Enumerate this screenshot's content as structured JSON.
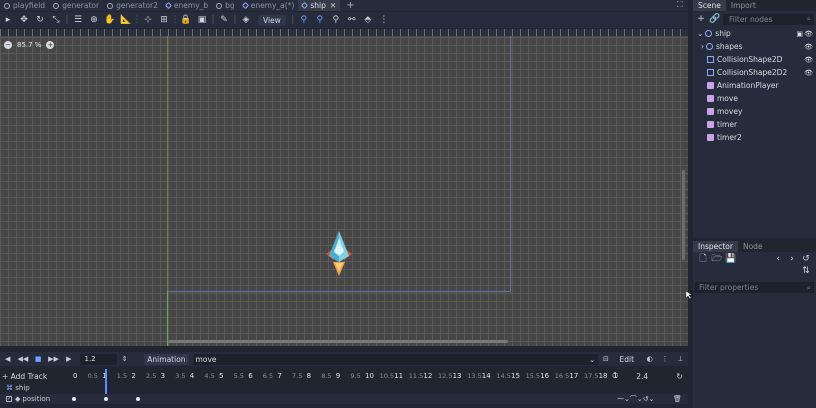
{
  "tabs": [
    {
      "label": "playfield",
      "icon": "circle"
    },
    {
      "label": "generator",
      "icon": "circle"
    },
    {
      "label": "generator2",
      "icon": "circle"
    },
    {
      "label": "enemy_b",
      "icon": "node2d"
    },
    {
      "label": "bg",
      "icon": "circle"
    },
    {
      "label": "enemy_a(*)",
      "icon": "node2d"
    },
    {
      "label": "ship",
      "icon": "node2d",
      "active": true
    }
  ],
  "toolbar": {
    "view_label": "View"
  },
  "viewport": {
    "zoom_label": "85.7 %"
  },
  "animation": {
    "time_value": "1.2",
    "animation_label": "Animation",
    "animation_name": "move",
    "edit_label": "Edit",
    "add_track_label": "Add Track",
    "length_value": "2.4",
    "ticks": [
      "0",
      "0.5",
      "1",
      "1.5",
      "2",
      "2.5",
      "3",
      "3.5",
      "4",
      "4.5",
      "5",
      "5.5",
      "6",
      "6.5",
      "7",
      "7.5",
      "8",
      "8.5",
      "9",
      "9.5",
      "10",
      "10.5",
      "11",
      "11.5",
      "12",
      "12.5",
      "13",
      "13.5",
      "14",
      "14.5",
      "15",
      "15.5",
      "16",
      "16.5",
      "17",
      "17.5",
      "18",
      "1"
    ],
    "track_group": "ship",
    "track_property": "position"
  },
  "scene_dock": {
    "tabs": [
      "Scene",
      "Import"
    ],
    "filter_placeholder": "Filter nodes",
    "nodes": [
      {
        "label": "ship",
        "icon": "n2d",
        "indent": 0,
        "visible": true
      },
      {
        "label": "shapes",
        "icon": "n2d",
        "indent": 1,
        "visible": true
      },
      {
        "label": "CollisionShape2D",
        "icon": "coll",
        "indent": 1,
        "visible": true
      },
      {
        "label": "CollisionShape2D2",
        "icon": "coll",
        "indent": 1,
        "visible": true
      },
      {
        "label": "AnimationPlayer",
        "icon": "other",
        "indent": 1,
        "visible": false
      },
      {
        "label": "move",
        "icon": "other",
        "indent": 1,
        "visible": false
      },
      {
        "label": "movey",
        "icon": "other",
        "indent": 1,
        "visible": false
      },
      {
        "label": "timer",
        "icon": "other",
        "indent": 1,
        "visible": false
      },
      {
        "label": "timer2",
        "icon": "other",
        "indent": 1,
        "visible": false
      }
    ]
  },
  "inspector_dock": {
    "tabs": [
      "Inspector",
      "Node"
    ],
    "filter_placeholder": "Filter properties"
  }
}
